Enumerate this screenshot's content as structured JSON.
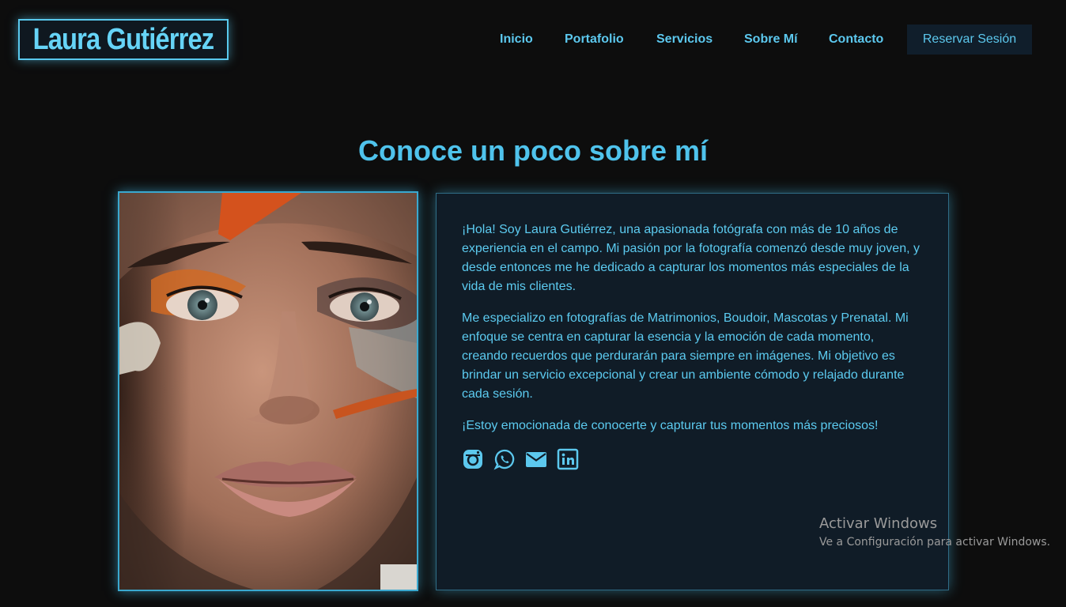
{
  "header": {
    "logo_text": "Laura Gutiérrez",
    "nav": [
      "Inicio",
      "Portafolio",
      "Servicios",
      "Sobre Mí",
      "Contacto"
    ],
    "cta_label": "Reservar Sesión"
  },
  "about": {
    "title": "Conoce un poco sobre mí",
    "paragraphs": [
      "¡Hola! Soy Laura Gutiérrez, una apasionada fotógrafa con más de 10 años de experiencia en el campo. Mi pasión por la fotografía comenzó desde muy joven, y desde entonces me he dedicado a capturar los momentos más especiales de la vida de mis clientes.",
      "Me especializo en fotografías de Matrimonios, Boudoir, Mascotas y Prenatal. Mi enfoque se centra en capturar la esencia y la emoción de cada momento, creando recuerdos que perdurarán para siempre en imágenes. Mi objetivo es brindar un servicio excepcional y crear un ambiente cómodo y relajado durante cada sesión.",
      "¡Estoy emocionada de conocerte y capturar tus momentos más preciosos!"
    ],
    "socials": [
      "instagram-icon",
      "whatsapp-icon",
      "email-icon",
      "linkedin-icon"
    ]
  },
  "watermark": {
    "title": "Activar Windows",
    "subtitle": "Ve a Configuración para activar Windows."
  },
  "colors": {
    "background": "#0d0d0d",
    "accent": "#5cc8ee",
    "card": "#101c27",
    "button": "#101e2b"
  }
}
